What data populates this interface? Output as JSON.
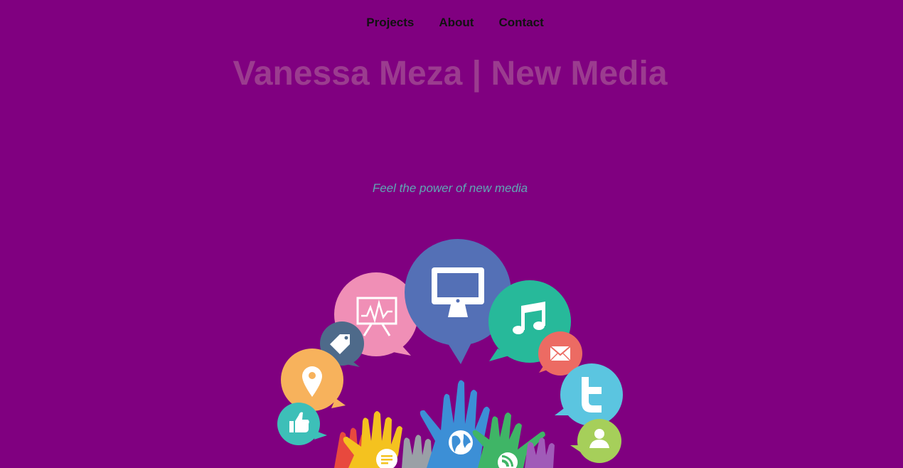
{
  "nav": {
    "items": [
      {
        "label": "Projects"
      },
      {
        "label": "About"
      },
      {
        "label": "Contact"
      }
    ]
  },
  "header": {
    "title": "Vanessa Meza | New Media"
  },
  "hero": {
    "tagline": "Feel the power of new media"
  },
  "colors": {
    "background": "#800080",
    "title": "#9b3c8f",
    "tagline": "#5fa8b5",
    "nav_text": "#111111"
  },
  "illustration": {
    "icons": [
      "presentation-icon",
      "monitor-icon",
      "music-note-icon",
      "tag-icon",
      "mail-icon",
      "location-pin-icon",
      "twitter-icon",
      "thumbs-up-icon",
      "user-icon",
      "globe-icon",
      "chat-icon",
      "rss-icon"
    ]
  }
}
